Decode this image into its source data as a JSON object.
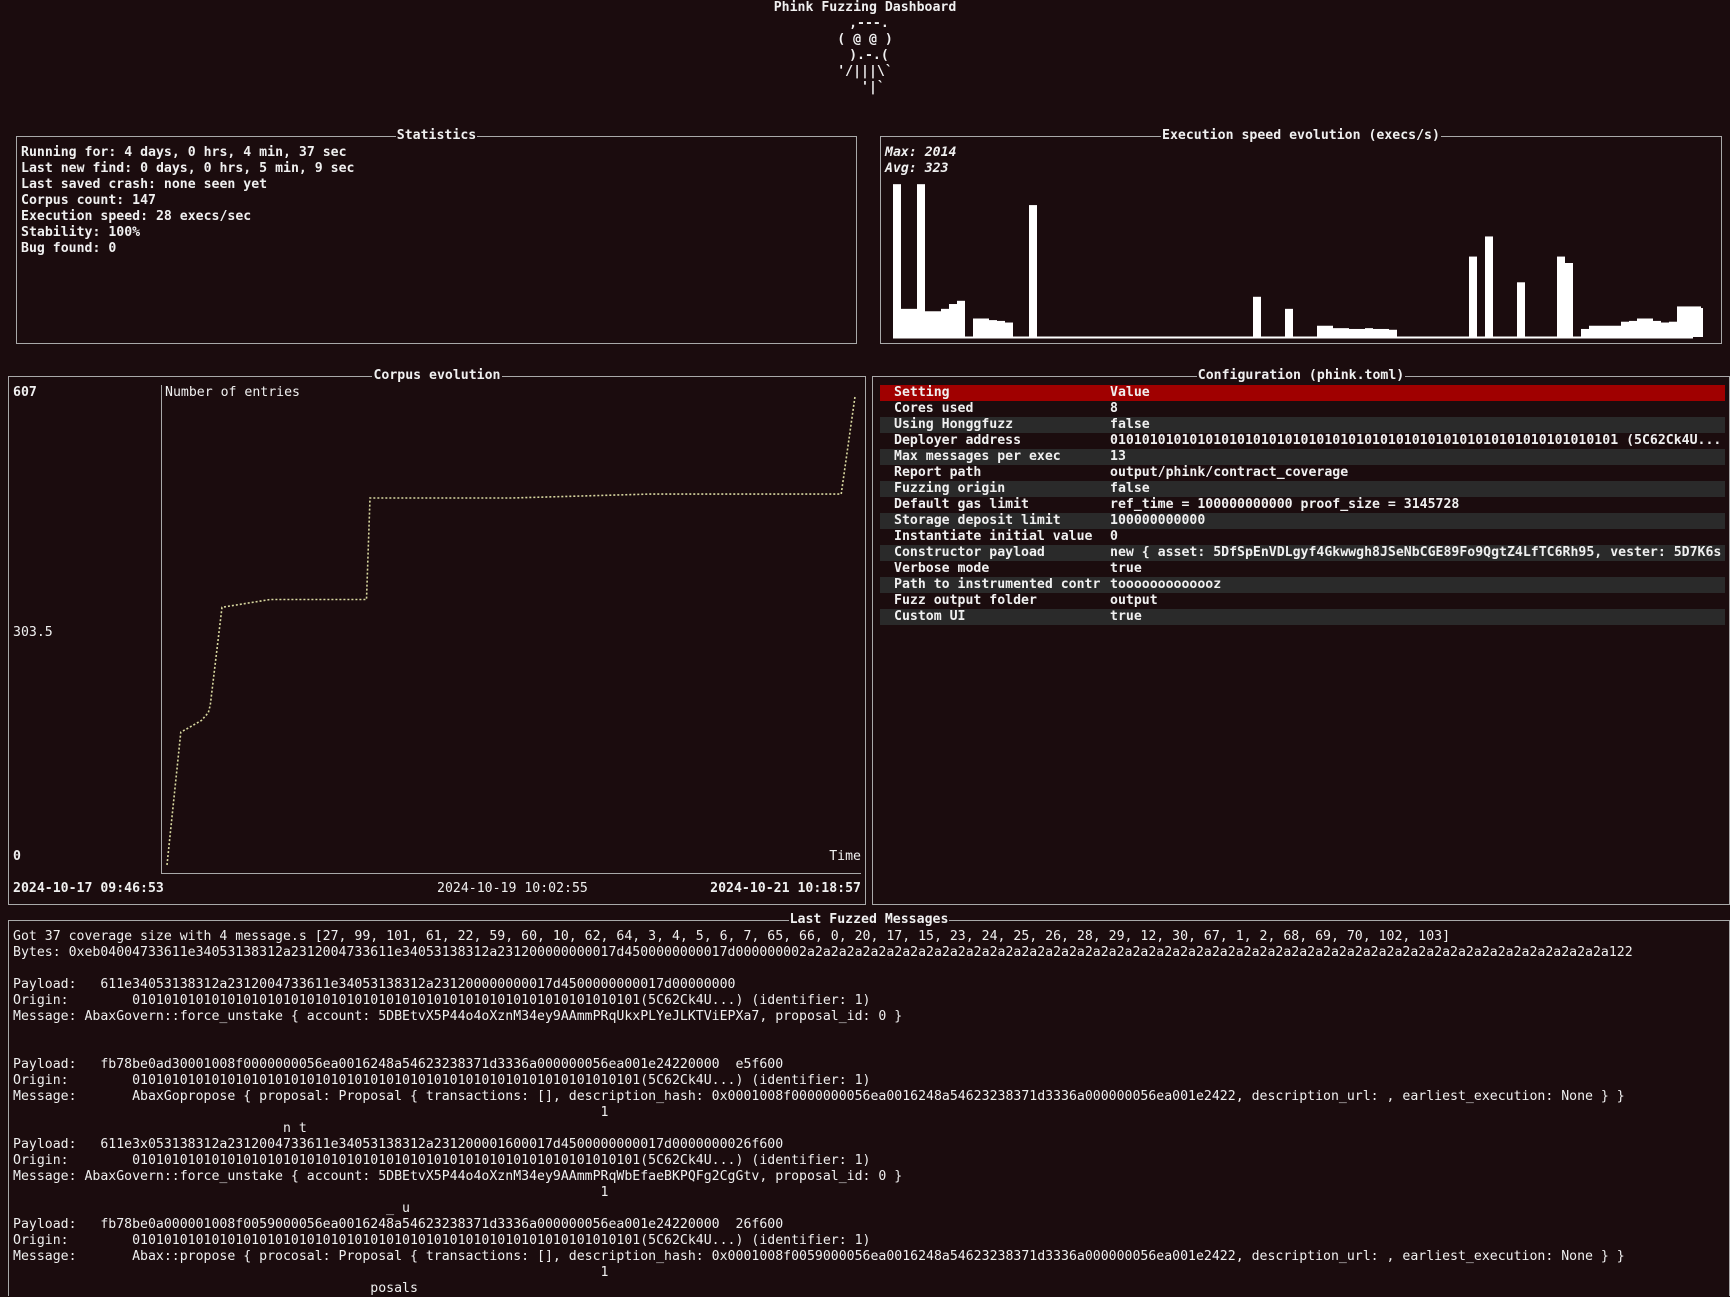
{
  "header": {
    "title": "Phink Fuzzing Dashboard",
    "mascot": " ,---.\n( @ @ )\n ).-.(\n'/|||\\`\n  '|`"
  },
  "statistics": {
    "title": "Statistics",
    "lines": [
      "Running for: 4 days, 0 hrs, 4 min, 37 sec",
      "Last new find: 0 days, 0 hrs, 5 min, 9 sec",
      "Last saved crash: none seen yet",
      "Corpus count: 147",
      "Execution speed: 28 execs/sec",
      "Stability: 100%",
      "Bug found: 0"
    ]
  },
  "exec_speed": {
    "title": "Execution speed evolution (execs/s)",
    "max_label": "Max: 2014",
    "avg_label": "Avg: 323",
    "bar_color": "#ffffff",
    "values": [
      1900,
      350,
      350,
      1900,
      320,
      320,
      350,
      410,
      450,
      0,
      230,
      230,
      210,
      200,
      180,
      0,
      0,
      1640,
      0,
      0,
      0,
      0,
      0,
      0,
      0,
      0,
      0,
      0,
      0,
      0,
      0,
      0,
      0,
      0,
      0,
      0,
      0,
      0,
      0,
      0,
      0,
      0,
      0,
      0,
      0,
      500,
      0,
      0,
      0,
      350,
      0,
      0,
      0,
      140,
      140,
      110,
      110,
      100,
      100,
      110,
      100,
      100,
      90,
      0,
      0,
      0,
      0,
      0,
      0,
      0,
      0,
      0,
      1000,
      0,
      1250,
      0,
      0,
      0,
      680,
      0,
      0,
      0,
      0,
      1000,
      920,
      0,
      100,
      140,
      140,
      140,
      140,
      190,
      200,
      230,
      230,
      200,
      180,
      190,
      380,
      380,
      380,
      360,
      390,
      400,
      400,
      430,
      500,
      560,
      540,
      520,
      560,
      620,
      620,
      640,
      640,
      640,
      640,
      630,
      0,
      0,
      0,
      0,
      0,
      0,
      0,
      0,
      0,
      0,
      0,
      0,
      0,
      0
    ]
  },
  "corpus": {
    "title": "Corpus evolution",
    "y_max_label": "607",
    "y_mid_label": "303.5",
    "y_min_label": "0",
    "series_label": "Number of entries",
    "x_axis_label": "Time",
    "x_start_label": "2024-10-17 09:46:53",
    "x_mid_label": "2024-10-19 10:02:55",
    "x_end_label": "2024-10-21 10:18:57",
    "line_color": "#d8d8a0",
    "chart_data": {
      "type": "line",
      "title": "Corpus evolution",
      "ylabel": "Number of entries",
      "xlabel": "Time",
      "ylim": [
        0,
        607
      ],
      "x": [
        0,
        0.02,
        0.05,
        0.06,
        0.063,
        0.08,
        0.15,
        0.29,
        0.295,
        0.5,
        0.7,
        0.98,
        1.0
      ],
      "y": [
        0,
        170,
        185,
        195,
        205,
        330,
        340,
        340,
        470,
        470,
        475,
        475,
        600
      ]
    }
  },
  "config": {
    "title": "Configuration (phink.toml)",
    "header": {
      "setting": "Setting",
      "value": "Value"
    },
    "rows": [
      {
        "setting": "Cores used",
        "value": "8"
      },
      {
        "setting": "Using Honggfuzz",
        "value": "false"
      },
      {
        "setting": "Deployer address",
        "value": "0101010101010101010101010101010101010101010101010101010101010101 (5C62Ck4U..."
      },
      {
        "setting": "Max messages per exec",
        "value": "13"
      },
      {
        "setting": "Report path",
        "value": "output/phink/contract_coverage"
      },
      {
        "setting": "Fuzzing origin",
        "value": "false"
      },
      {
        "setting": "Default gas limit",
        "value": "ref_time = 100000000000 proof_size = 3145728"
      },
      {
        "setting": "Storage deposit limit",
        "value": "100000000000"
      },
      {
        "setting": "Instantiate initial value",
        "value": "0"
      },
      {
        "setting": "Constructor payload",
        "value": "new { asset: 5DfSpEnVDLgyf4Gkwwgh8JSeNbCGE89Fo9QgtZ4LfTC6Rh95, vester: 5D7K6s"
      },
      {
        "setting": "Verbose mode",
        "value": "true"
      },
      {
        "setting": "Path to instrumented contr",
        "value": "tooooooooooooz"
      },
      {
        "setting": "Fuzz output folder",
        "value": "output"
      },
      {
        "setting": "Custom UI",
        "value": "true"
      }
    ]
  },
  "messages": {
    "title": "Last Fuzzed Messages",
    "lines": [
      "Got 37 coverage size with 4 message.s [27, 99, 101, 61, 22, 59, 60, 10, 62, 64, 3, 4, 5, 6, 7, 65, 66, 0, 20, 17, 15, 23, 24, 25, 26, 28, 29, 12, 30, 67, 1, 2, 68, 69, 70, 102, 103]",
      "Bytes: 0xeb04004733611e34053138312a2312004733611e34053138312a231200000000017d4500000000017d000000002a2a2a2a2a2a2a2a2a2a2a2a2a2a2a2a2a2a2a2a2a2a2a2a2a2a2a2a2a2a2a2a2a2a2a2a2a2a2a2a2a2a2a2a2a2a2a2a2a2a2a122",
      "",
      "Payload:   611e34053138312a2312004733611e34053138312a231200000000017d4500000000017d00000000",
      "Origin:        0101010101010101010101010101010101010101010101010101010101010101(5C62Ck4U...) (identifier: 1)",
      "Message: AbaxGovern::force_unstake { account: 5DBEtvX5P44o4oXznM34ey9AAmmPRqUkxPLYeJLKTViEPXa7, proposal_id: 0 }",
      "",
      "",
      "Payload:   fb78be0ad30001008f0000000056ea0016248a54623238371d3336a000000056ea001e24220000  e5f600",
      "Origin:        0101010101010101010101010101010101010101010101010101010101010101(5C62Ck4U...) (identifier: 1)",
      "Message:       AbaxGopropose { proposal: Proposal { transactions: [], description_hash: 0x0001008f0000000056ea0016248a54623238371d3336a000000056ea001e2422, description_url: , earliest_execution: None } }",
      "                                                                          1",
      "                                  n t",
      "Payload:   611e3x053138312a2312004733611e34053138312a231200001600017d4500000000017d0000000026f600",
      "Origin:        0101010101010101010101010101010101010101010101010101010101010101(5C62Ck4U...) (identifier: 1)",
      "Message: AbaxGovern::force_unstake { account: 5DBEtvX5P44o4oXznM34ey9AAmmPRqWbEfaeBKPQFg2CgGtv, proposal_id: 0 }",
      "                                                                          1",
      "                                               _ u",
      "Payload:   fb78be0a000001008f0059000056ea0016248a54623238371d3336a000000056ea001e24220000  26f600",
      "Origin:        0101010101010101010101010101010101010101010101010101010101010101(5C62Ck4U...) (identifier: 1)",
      "Message:       Abax::propose { procosal: Proposal { transactions: [], description_hash: 0x0001008f0059000056ea0016248a54623238371d3336a000000056ea001e2422, description_url: , earliest_execution: None } }",
      "                                                                          1",
      "                                             posals"
    ]
  }
}
